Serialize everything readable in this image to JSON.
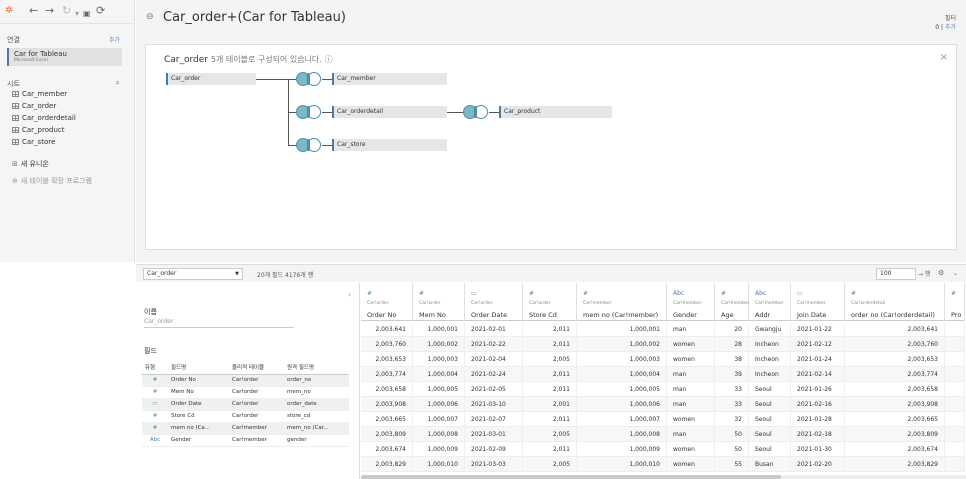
{
  "toolbar": {
    "logo": "✲",
    "back": "←",
    "forward": "→",
    "redo": "↻",
    "save": "▣",
    "refresh": "⟳"
  },
  "connections": {
    "label": "연결",
    "add": "추가",
    "name": "Car for Tableau",
    "type": "Microsoft Excel"
  },
  "sheets": {
    "label": "시트",
    "search_icon": "⌕",
    "items": [
      "Car_member",
      "Car_order",
      "Car_orderdetail",
      "Car_product",
      "Car_store"
    ],
    "new_union": "새 유니온",
    "new_extension": "새 테이블 확장 프로그램"
  },
  "datasource": {
    "title": "Car_order+(Car for Tableau)"
  },
  "filters": {
    "label": "필터",
    "count": "0",
    "add": "추가"
  },
  "canvas": {
    "table": "Car_order",
    "caption_sub": "5개 테이블로 구성되어 있습니다.",
    "info_icon": "ⓘ",
    "close": "×",
    "tables": [
      "Car_order",
      "Car_member",
      "Car_orderdetail",
      "Car_product",
      "Car_store"
    ]
  },
  "bottom_bar": {
    "table_select": "Car_order",
    "info": "20개 필드 4176개 행",
    "rows": "100",
    "rows_suffix": "→ 행"
  },
  "metadata": {
    "name_label": "이름",
    "name_value": "Car_order",
    "fields_label": "필드",
    "columns": [
      "유형",
      "필드명",
      "물리적 테이블",
      "원격 필드명"
    ],
    "fields": [
      [
        "#",
        "Order No",
        "Car!order",
        "order_no"
      ],
      [
        "#",
        "Mem No",
        "Car!order",
        "mem_no"
      ],
      [
        "▭",
        "Order Date",
        "Car!order",
        "order_date"
      ],
      [
        "#",
        "Store Cd",
        "Car!order",
        "store_cd"
      ],
      [
        "#",
        "mem no (Ca...",
        "Car!member",
        "mem_no (Car..."
      ],
      [
        "Abc",
        "Gender",
        "Car!member",
        "gender"
      ]
    ]
  },
  "grid": {
    "columns": [
      {
        "icon": "#",
        "source": "Car!order",
        "name": "Order No",
        "align": "num"
      },
      {
        "icon": "#",
        "source": "Car!order",
        "name": "Mem No",
        "align": "num"
      },
      {
        "icon": "▭",
        "source": "Car!order",
        "name": "Order Date",
        "align": "left"
      },
      {
        "icon": "#",
        "source": "Car!order",
        "name": "Store Cd",
        "align": "num"
      },
      {
        "icon": "#",
        "source": "Car!member",
        "name": "mem no (Car!member)",
        "align": "num"
      },
      {
        "icon": "Abc",
        "source": "Car!member",
        "name": "Gender",
        "align": "left"
      },
      {
        "icon": "#",
        "source": "Car!member",
        "name": "Age",
        "align": "num"
      },
      {
        "icon": "Abc",
        "source": "Car!member",
        "name": "Addr",
        "align": "left"
      },
      {
        "icon": "▭",
        "source": "Car!member",
        "name": "Join Date",
        "align": "left"
      },
      {
        "icon": "#",
        "source": "Car!orderdetail",
        "name": "order no (Car!orderdetail)",
        "align": "num"
      },
      {
        "icon": "#",
        "source": "",
        "name": "Pro",
        "align": "left"
      }
    ],
    "rows": [
      [
        "2,003,641",
        "1,000,001",
        "2021-02-01",
        "2,011",
        "1,000,001",
        "man",
        "20",
        "Gwangju",
        "2021-01-22",
        "2,003,641",
        ""
      ],
      [
        "2,003,760",
        "1,000,002",
        "2021-02-22",
        "2,011",
        "1,000,002",
        "women",
        "28",
        "Incheon",
        "2021-02-12",
        "2,003,760",
        ""
      ],
      [
        "2,003,653",
        "1,000,003",
        "2021-02-04",
        "2,005",
        "1,000,003",
        "women",
        "38",
        "Incheon",
        "2021-01-24",
        "2,003,653",
        ""
      ],
      [
        "2,003,774",
        "1,000,004",
        "2021-02-24",
        "2,011",
        "1,000,004",
        "man",
        "39",
        "Incheon",
        "2021-02-14",
        "2,003,774",
        ""
      ],
      [
        "2,003,658",
        "1,000,005",
        "2021-02-05",
        "2,011",
        "1,000,005",
        "man",
        "33",
        "Seoul",
        "2021-01-26",
        "2,003,658",
        ""
      ],
      [
        "2,003,908",
        "1,000,006",
        "2021-03-10",
        "2,001",
        "1,000,006",
        "man",
        "33",
        "Seoul",
        "2021-02-16",
        "2,003,908",
        ""
      ],
      [
        "2,003,665",
        "1,000,007",
        "2021-02-07",
        "2,011",
        "1,000,007",
        "women",
        "32",
        "Seoul",
        "2021-01-28",
        "2,003,665",
        ""
      ],
      [
        "2,003,809",
        "1,000,008",
        "2021-03-01",
        "2,005",
        "1,000,008",
        "man",
        "50",
        "Seoul",
        "2021-02-18",
        "2,003,809",
        ""
      ],
      [
        "2,003,674",
        "1,000,009",
        "2021-02-09",
        "2,011",
        "1,000,009",
        "women",
        "50",
        "Seoul",
        "2021-01-30",
        "2,003,674",
        ""
      ],
      [
        "2,003,829",
        "1,000,010",
        "2021-03-03",
        "2,005",
        "1,000,010",
        "women",
        "55",
        "Busan",
        "2021-02-20",
        "2,003,829",
        ""
      ]
    ]
  },
  "colors": {
    "accent": "#4e79a7",
    "join": "#7fb7c9",
    "numeric": "#5a9a6b"
  }
}
